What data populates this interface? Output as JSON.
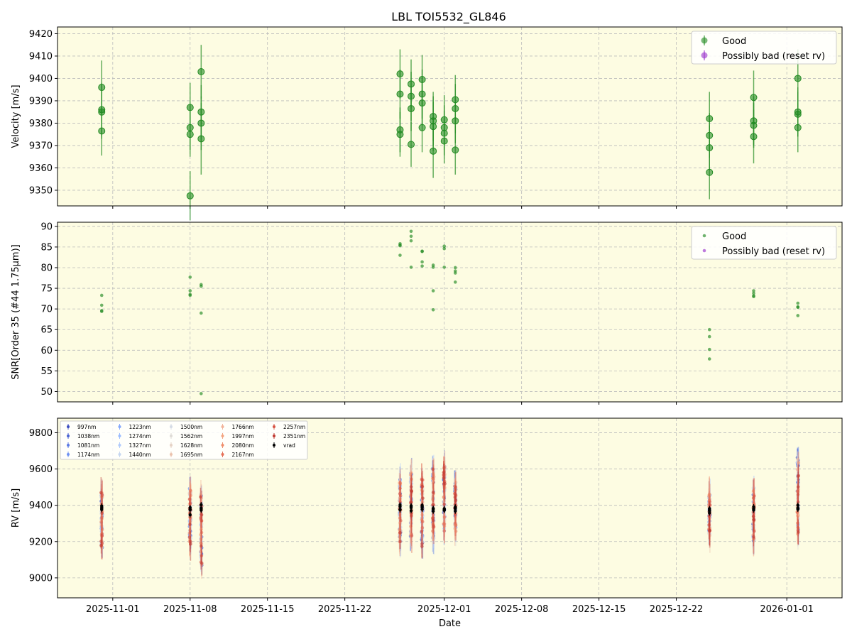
{
  "figure": {
    "title": "LBL TOI5532_GL846"
  },
  "chart_data": [
    {
      "type": "scatter",
      "panel": "velocity",
      "ylabel": "Velocity [m/s]",
      "xlabel": "",
      "ylim": [
        9343,
        9423
      ],
      "yticks": [
        9350,
        9360,
        9370,
        9380,
        9390,
        9400,
        9410,
        9420
      ],
      "grid": true,
      "legend": {
        "placement": "top-right",
        "entries": [
          "Good",
          "Possibly bad (reset rv)"
        ]
      },
      "series": [
        {
          "name": "Good",
          "color": "#228B22",
          "x": [
            "2025-10-31",
            "2025-10-31",
            "2025-10-31",
            "2025-10-31",
            "2025-11-08",
            "2025-11-08",
            "2025-11-08",
            "2025-11-08",
            "2025-11-09",
            "2025-11-09",
            "2025-11-09",
            "2025-11-09",
            "2025-11-27",
            "2025-11-27",
            "2025-11-27",
            "2025-11-27",
            "2025-11-28",
            "2025-11-28",
            "2025-11-28",
            "2025-11-28",
            "2025-11-29",
            "2025-11-29",
            "2025-11-29",
            "2025-11-29",
            "2025-11-30",
            "2025-11-30",
            "2025-11-30",
            "2025-11-30",
            "2025-12-01",
            "2025-12-01",
            "2025-12-01",
            "2025-12-01",
            "2025-12-02",
            "2025-12-02",
            "2025-12-02",
            "2025-12-02",
            "2025-12-25",
            "2025-12-25",
            "2025-12-25",
            "2025-12-25",
            "2025-12-29",
            "2025-12-29",
            "2025-12-29",
            "2025-12-29",
            "2026-01-02",
            "2026-01-02",
            "2026-01-02",
            "2026-01-02"
          ],
          "y": [
            9396,
            9386,
            9385,
            9376.5,
            9387,
            9378,
            9375,
            9347.5,
            9403,
            9385,
            9380,
            9373,
            9402,
            9393,
            9377,
            9375,
            9397.5,
            9392,
            9386.5,
            9370.5,
            9399.5,
            9393,
            9389,
            9378,
            9383,
            9381,
            9378.5,
            9367.5,
            9381.5,
            9378,
            9375.5,
            9372,
            9390.5,
            9386.5,
            9381,
            9368,
            9382,
            9374.5,
            9369,
            9358,
            9391.5,
            9381,
            9379,
            9374,
            9400,
            9385,
            9384,
            9378
          ],
          "yerr": [
            12,
            12,
            12,
            11,
            11,
            10,
            10,
            11,
            12,
            12,
            12,
            16,
            11,
            11,
            10,
            10,
            11,
            11,
            10,
            10,
            11,
            11,
            10,
            11,
            11,
            11,
            11,
            12,
            11,
            10,
            10,
            10,
            11,
            11,
            10,
            11,
            12,
            10,
            10,
            12,
            12,
            11,
            10,
            12,
            13,
            11,
            10,
            11
          ]
        },
        {
          "name": "Possibly bad (reset rv)",
          "color": "#9932CC",
          "x": [],
          "y": []
        }
      ]
    },
    {
      "type": "scatter",
      "panel": "snr",
      "ylabel": "SNR[Order 35 (#44 1.75μm)]",
      "xlabel": "",
      "ylim": [
        47.5,
        91
      ],
      "yticks": [
        50,
        55,
        60,
        65,
        70,
        75,
        80,
        85,
        90
      ],
      "grid": true,
      "legend": {
        "placement": "top-right",
        "entries": [
          "Good",
          "Possibly bad (reset rv)"
        ]
      },
      "series": [
        {
          "name": "Good",
          "color": "#228B22",
          "x": [
            "2025-10-31",
            "2025-10-31",
            "2025-10-31",
            "2025-10-31",
            "2025-11-08",
            "2025-11-08",
            "2025-11-08",
            "2025-11-08",
            "2025-11-09",
            "2025-11-09",
            "2025-11-09",
            "2025-11-09",
            "2025-11-27",
            "2025-11-27",
            "2025-11-27",
            "2025-11-27",
            "2025-11-28",
            "2025-11-28",
            "2025-11-28",
            "2025-11-28",
            "2025-11-29",
            "2025-11-29",
            "2025-11-29",
            "2025-11-29",
            "2025-11-30",
            "2025-11-30",
            "2025-11-30",
            "2025-11-30",
            "2025-12-01",
            "2025-12-01",
            "2025-12-01",
            "2025-12-02",
            "2025-12-02",
            "2025-12-02",
            "2025-12-02",
            "2025-12-25",
            "2025-12-25",
            "2025-12-25",
            "2025-12-25",
            "2025-12-29",
            "2025-12-29",
            "2025-12-29",
            "2025-12-29",
            "2026-01-02",
            "2026-01-02",
            "2026-01-02",
            "2026-01-02"
          ],
          "y": [
            73.3,
            70.9,
            69.6,
            69.4,
            77.7,
            74.4,
            73.5,
            73.3,
            75.9,
            75.5,
            69.0,
            49.5,
            85.8,
            85.5,
            85.3,
            83.0,
            88.8,
            87.6,
            86.5,
            80.1,
            84.0,
            83.9,
            81.4,
            80.4,
            80.6,
            80.1,
            74.4,
            69.8,
            85.2,
            84.6,
            80.1,
            80.0,
            79.2,
            78.7,
            76.5,
            65.0,
            63.3,
            60.2,
            57.9,
            74.4,
            73.8,
            73.2,
            73.0,
            71.4,
            70.5,
            70.4,
            68.4
          ]
        },
        {
          "name": "Possibly bad (reset rv)",
          "color": "#9932CC",
          "x": [],
          "y": []
        }
      ]
    },
    {
      "type": "scatter",
      "panel": "rv",
      "ylabel": "RV [m/s]",
      "xlabel": "Date",
      "ylim": [
        8890,
        9880
      ],
      "yticks": [
        9000,
        9200,
        9400,
        9600,
        9800
      ],
      "xlim": [
        "2025-10-27",
        "2026-01-06"
      ],
      "xticks": [
        "2025-11-01",
        "2025-11-08",
        "2025-11-15",
        "2025-11-22",
        "2025-12-01",
        "2025-12-08",
        "2025-12-15",
        "2025-12-22",
        "2026-01-01"
      ],
      "grid": true,
      "legend": {
        "placement": "top-left",
        "entries": [
          "997nm",
          "1038nm",
          "1081nm",
          "1174nm",
          "1223nm",
          "1274nm",
          "1327nm",
          "1440nm",
          "1500nm",
          "1562nm",
          "1628nm",
          "1695nm",
          "1766nm",
          "1997nm",
          "2080nm",
          "2167nm",
          "2257nm",
          "2351nm",
          "vrad"
        ]
      },
      "band_colors": [
        "#3b4cc0",
        "#4a63d3",
        "#5b7ae5",
        "#6f92f3",
        "#85a8fc",
        "#9bbcff",
        "#b1cbfc",
        "#c6d6f1",
        "#d5dbe5",
        "#dfdcd7",
        "#e6d3c6",
        "#ebc3ad",
        "#f2b39a",
        "#f3a481",
        "#ef8e6c",
        "#e57058",
        "#d75445",
        "#c03b33"
      ],
      "vrad": {
        "name": "vrad",
        "color": "#000000",
        "x": [
          "2025-10-31",
          "2025-10-31",
          "2025-10-31",
          "2025-10-31",
          "2025-11-08",
          "2025-11-08",
          "2025-11-08",
          "2025-11-08",
          "2025-11-09",
          "2025-11-09",
          "2025-11-09",
          "2025-11-09",
          "2025-11-27",
          "2025-11-27",
          "2025-11-27",
          "2025-11-27",
          "2025-11-28",
          "2025-11-28",
          "2025-11-28",
          "2025-11-28",
          "2025-11-29",
          "2025-11-29",
          "2025-11-29",
          "2025-11-29",
          "2025-11-30",
          "2025-11-30",
          "2025-11-30",
          "2025-11-30",
          "2025-12-01",
          "2025-12-01",
          "2025-12-01",
          "2025-12-01",
          "2025-12-02",
          "2025-12-02",
          "2025-12-02",
          "2025-12-02",
          "2025-12-25",
          "2025-12-25",
          "2025-12-25",
          "2025-12-25",
          "2025-12-29",
          "2025-12-29",
          "2025-12-29",
          "2025-12-29",
          "2026-01-02",
          "2026-01-02",
          "2026-01-02",
          "2026-01-02"
        ],
        "y": [
          9396,
          9386,
          9385,
          9376.5,
          9387,
          9378,
          9375,
          9347.5,
          9403,
          9385,
          9380,
          9373,
          9402,
          9393,
          9377,
          9375,
          9397.5,
          9392,
          9386.5,
          9370.5,
          9399.5,
          9393,
          9389,
          9378,
          9383,
          9381,
          9378.5,
          9367.5,
          9381.5,
          9378,
          9375.5,
          9372,
          9390.5,
          9386.5,
          9381,
          9368,
          9382,
          9374.5,
          9369,
          9358,
          9391.5,
          9381,
          9379,
          9374,
          9400,
          9385,
          9384,
          9378
        ]
      },
      "band_scatter": {
        "2025-10-31": [
          9100,
          9550
        ],
        "2025-11-08": [
          9120,
          9560
        ],
        "2025-11-09": [
          8980,
          9550
        ],
        "2025-11-27": [
          9120,
          9620
        ],
        "2025-11-28": [
          9150,
          9660
        ],
        "2025-11-29": [
          9090,
          9640
        ],
        "2025-11-30": [
          9130,
          9690
        ],
        "2025-12-01": [
          9180,
          9700
        ],
        "2025-12-02": [
          9190,
          9590
        ],
        "2025-12-25": [
          9170,
          9520
        ],
        "2025-12-29": [
          9140,
          9560
        ],
        "2026-01-02": [
          9130,
          9760
        ]
      }
    }
  ]
}
